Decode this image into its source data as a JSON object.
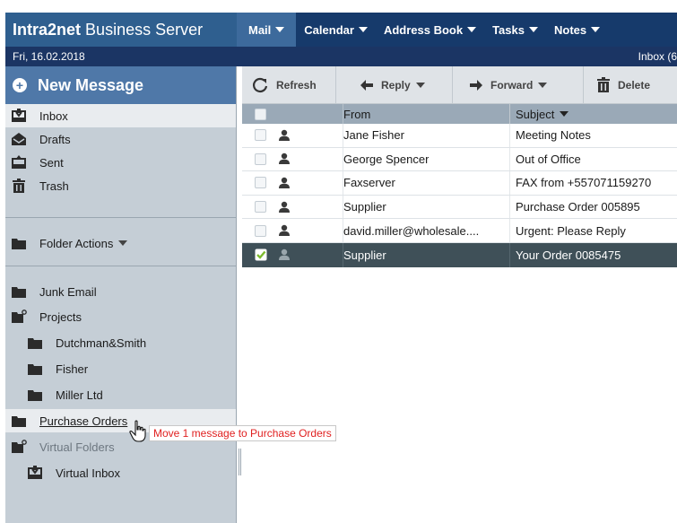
{
  "app": {
    "logo_brand": "Intra2net",
    "logo_product": "Business Server"
  },
  "menu": [
    {
      "label": "Mail",
      "active": true
    },
    {
      "label": "Calendar",
      "active": false
    },
    {
      "label": "Address Book",
      "active": false
    },
    {
      "label": "Tasks",
      "active": false
    },
    {
      "label": "Notes",
      "active": false
    }
  ],
  "datebar": {
    "date": "Fri, 16.02.2018",
    "inbox_count": "Inbox (6"
  },
  "sidebar": {
    "new_message": "New Message",
    "folders": [
      {
        "label": "Inbox",
        "icon": "inbox-icon",
        "selected": true
      },
      {
        "label": "Drafts",
        "icon": "drafts-icon",
        "selected": false
      },
      {
        "label": "Sent",
        "icon": "sent-icon",
        "selected": false
      },
      {
        "label": "Trash",
        "icon": "trash-icon",
        "selected": false
      }
    ],
    "folder_actions": "Folder Actions",
    "custom_folders": [
      {
        "label": "Junk Email",
        "icon": "folder-icon"
      },
      {
        "label": "Projects",
        "icon": "folder-open-icon"
      },
      {
        "label": "Dutchman&Smith",
        "icon": "folder-icon"
      },
      {
        "label": "Fisher",
        "icon": "folder-icon"
      },
      {
        "label": "Miller Ltd",
        "icon": "folder-icon"
      },
      {
        "label": "Purchase Orders",
        "icon": "folder-icon"
      },
      {
        "label": "Virtual Folders",
        "icon": "folder-open-icon"
      },
      {
        "label": "Virtual Inbox",
        "icon": "inbox-icon"
      }
    ],
    "drag_tooltip": "Move 1 message to Purchase Orders"
  },
  "toolbar": {
    "refresh": "Refresh",
    "reply": "Reply",
    "forward": "Forward",
    "delete": "Delete"
  },
  "grid": {
    "columns": {
      "from": "From",
      "subject": "Subject"
    },
    "rows": [
      {
        "from": "Jane Fisher",
        "subject": "Meeting Notes",
        "checked": false,
        "selected": false
      },
      {
        "from": "George Spencer",
        "subject": "Out of Office",
        "checked": false,
        "selected": false
      },
      {
        "from": "Faxserver",
        "subject": "FAX from +557071159270",
        "checked": false,
        "selected": false
      },
      {
        "from": "Supplier",
        "subject": "Purchase Order 005895",
        "checked": false,
        "selected": false
      },
      {
        "from": "david.miller@wholesale....",
        "subject": "Urgent: Please Reply",
        "checked": false,
        "selected": false
      },
      {
        "from": "Supplier",
        "subject": "Your Order 0085475",
        "checked": true,
        "selected": true
      }
    ]
  },
  "colors": {
    "menu_bg": "#163a6b",
    "logo_bg": "#2f5f8f",
    "date_bg": "#1b3564",
    "new_msg_bg": "#4f78a8",
    "sidebar_bg": "#c5ced6",
    "selected_row": "#3f5058",
    "check_green": "#7dbb2e",
    "tooltip_text": "#e02020"
  }
}
